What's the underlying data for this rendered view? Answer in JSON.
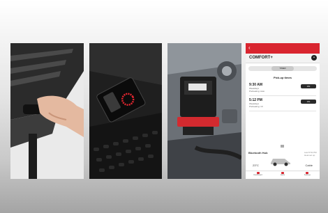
{
  "app": {
    "title": "COMFORT+",
    "tabs": [
      "",
      "TIMER",
      ""
    ],
    "pickup_title": "Pick-up times",
    "rows": [
      {
        "time": "9:30 AM",
        "days": "Weekdays",
        "sub": "Preheating: Auto",
        "toggle": "ON"
      },
      {
        "time": "5:12 PM",
        "days": "Weekdays",
        "sub": "Preheating: 10",
        "toggle": "ON"
      }
    ],
    "hub": {
      "label": "Bluetooth Hub",
      "status": "Last 5:51 PM Heat set up",
      "temp": "23°C",
      "cable": "Cable"
    },
    "bottom_tabs": [
      "Dashboard",
      "Alerts",
      "Settings"
    ]
  },
  "icons": {
    "back": "chevron-left-icon",
    "more": "more-icon",
    "car": "car-icon"
  },
  "colors": {
    "accent": "#d9252f"
  }
}
